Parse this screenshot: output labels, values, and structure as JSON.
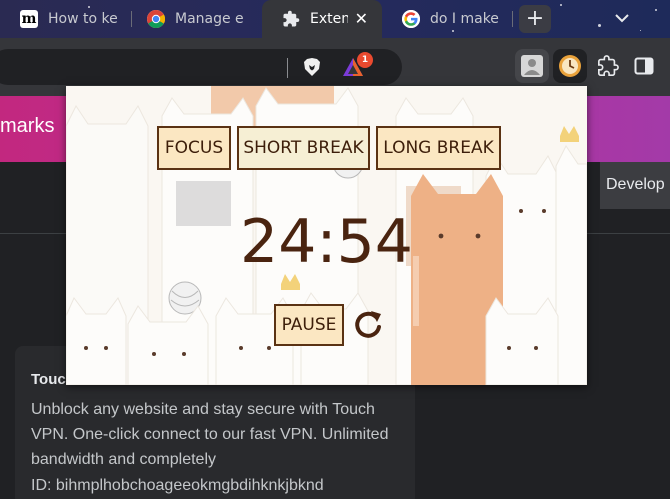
{
  "browser": {
    "tabs": [
      {
        "label": "How to ke",
        "favicon": "medium-icon",
        "active": false
      },
      {
        "label": "Manage e",
        "favicon": "chrome-icon",
        "active": false
      },
      {
        "label": "Exten",
        "favicon": "puzzle-extension-icon",
        "active": true
      },
      {
        "label": "do I make",
        "favicon": "google-icon",
        "active": false
      }
    ],
    "new_tab_label": "+",
    "notification_badge": "1"
  },
  "page": {
    "header_partial": "marks",
    "developer_partial": "Develop",
    "extension_card": {
      "title_partial": "Touc",
      "description": "Unblock any website and stay secure with Touch VPN. One-click connect to our fast VPN. Unlimited bandwidth and completely",
      "id_text": "ID: bihmplhobchoageeokmgbdihknkjbknd"
    }
  },
  "popup": {
    "modes": [
      {
        "label": "FOCUS",
        "active": false
      },
      {
        "label": "SHORT BREAK",
        "active": true
      },
      {
        "label": "LONG BREAK",
        "active": false
      }
    ],
    "timer": "24:54",
    "pause_label": "PAUSE",
    "colors": {
      "button_bg": "#fbe7c2",
      "button_border": "#5a3213",
      "timer_text": "#4a2410"
    }
  }
}
